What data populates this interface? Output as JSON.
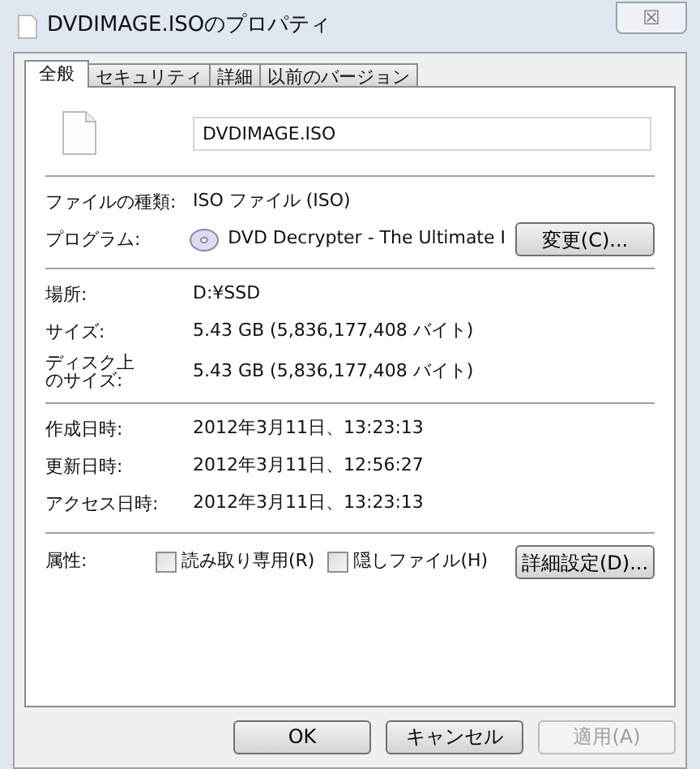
{
  "window": {
    "title": "DVDIMAGE.ISOのプロパティ",
    "close": "☒"
  },
  "tabs": [
    {
      "label": "全般",
      "selected": true
    },
    {
      "label": "セキュリティ",
      "selected": false
    },
    {
      "label": "詳細",
      "selected": false
    },
    {
      "label": "以前のバージョン",
      "selected": false
    }
  ],
  "file_name": "DVDIMAGE.ISO",
  "sections": [
    [
      {
        "label": "ファイルの種類:",
        "value": "ISO ファイル (ISO)",
        "kind": "text"
      },
      {
        "label": "プログラム:",
        "value": "DVD Decrypter - The Ultimate I",
        "kind": "program",
        "button": "変更(C)..."
      }
    ],
    [
      {
        "label": "場所:",
        "value": "D:¥SSD",
        "kind": "text"
      },
      {
        "label": "サイズ:",
        "value": "5.43 GB (5,836,177,408 バイト)",
        "kind": "text"
      },
      {
        "label": "ディスク上のサイズ:",
        "value": "5.43 GB (5,836,177,408 バイト)",
        "kind": "text",
        "wrapped": true
      }
    ],
    [
      {
        "label": "作成日時:",
        "value": "2012年3月11日、13:23:13",
        "kind": "text"
      },
      {
        "label": "更新日時:",
        "value": "2012年3月11日、12:56:27",
        "kind": "text"
      },
      {
        "label": "アクセス日時:",
        "value": "2012年3月11日、13:23:13",
        "kind": "text"
      }
    ]
  ],
  "attributes": {
    "label": "属性:",
    "checkboxes": [
      {
        "label": "読み取り専用(R)",
        "checked": false
      },
      {
        "label": "隠しファイル(H)",
        "checked": false
      }
    ],
    "button": "詳細設定(D)..."
  },
  "buttons": [
    {
      "label": "OK",
      "disabled": false
    },
    {
      "label": "キャンセル",
      "disabled": false
    },
    {
      "label": "適用(A)",
      "disabled": true
    }
  ]
}
